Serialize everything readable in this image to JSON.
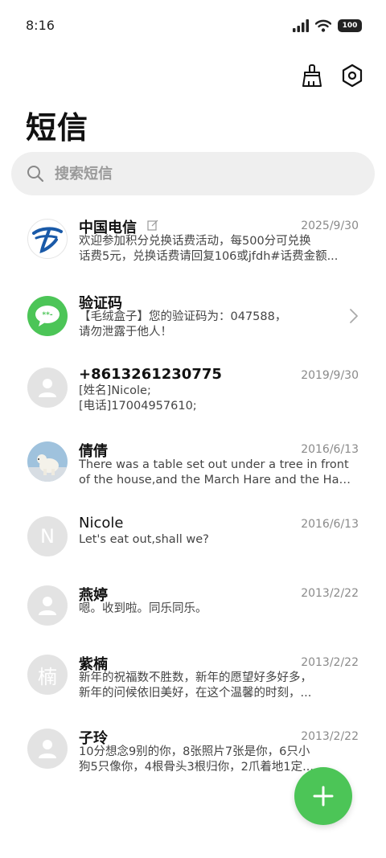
{
  "status": {
    "time": "8:16",
    "battery": "100"
  },
  "header": {
    "title": "短信"
  },
  "search": {
    "placeholder": "搜索短信"
  },
  "conversations": [
    {
      "name": "中国电信",
      "date": "2025/9/30",
      "lines": [
        "欢迎参加积分兑换话费活动，每500分可兑换",
        "话费5元，兑换话费请回复106或jfdh#话费金额..."
      ],
      "avatar": "china-telecom-logo"
    },
    {
      "name": "验证码",
      "date": "",
      "lines": [
        "【毛绒盒子】您的验证码为：047588，",
        "请勿泄露于他人！"
      ],
      "avatar": "message-bubble-icon"
    },
    {
      "name": "+8613261230775",
      "date": "2019/9/30",
      "lines": [
        "[姓名]Nicole;",
        "[电话]17004957610;"
      ],
      "avatar": "person-icon"
    },
    {
      "name": "倩倩",
      "date": "2016/6/13",
      "lines": [
        "There was a table set out under a tree in front",
        "of the house,and the March Hare and the Hatter were..."
      ],
      "avatar": "polar-bear-photo"
    },
    {
      "name": "Nicole",
      "date": "2016/6/13",
      "lines": [
        "Let's eat out,shall we?"
      ],
      "avatar_letter": "N"
    },
    {
      "name": "燕婷",
      "date": "2013/2/22",
      "lines": [
        "嗯。收到啦。同乐同乐。"
      ],
      "avatar": "person-icon"
    },
    {
      "name": "紫楠",
      "date": "2013/2/22",
      "lines": [
        "新年的祝福数不胜数，新年的愿望好多好多，",
        "新年的问候依旧美好，在这个温馨的时刻，..."
      ],
      "avatar_letter": "楠"
    },
    {
      "name": "子玲",
      "date": "2013/2/22",
      "lines": [
        "10分想念9别的你，8张照片7张是你，6只小",
        "狗5只像你，4根骨头3根归你，2爪着地1定..."
      ],
      "avatar": "person-icon"
    }
  ],
  "colors": {
    "accent": "#4cc557",
    "telecom_blue": "#1a5aa8",
    "avatar_grey": "#e3e3e3"
  }
}
